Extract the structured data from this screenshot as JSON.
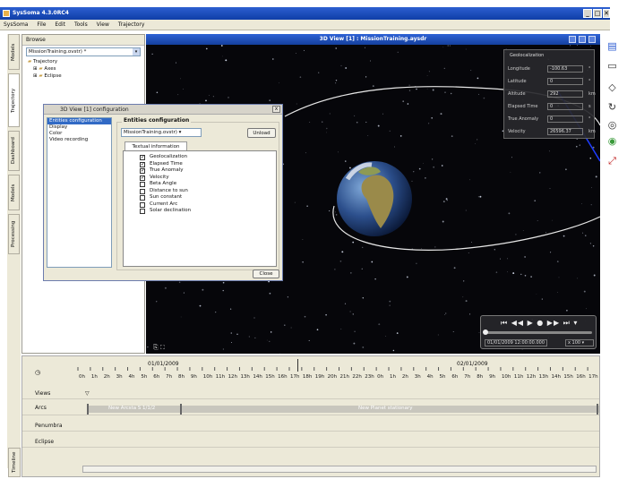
{
  "window": {
    "title": "SysSoma 4.3.0RC4",
    "btn_min": "_",
    "btn_max": "□",
    "btn_close": "✕"
  },
  "menu": [
    "SysSoma",
    "File",
    "Edit",
    "Tools",
    "View",
    "Trajectory"
  ],
  "left_tabs": [
    "Models",
    "Trajectory",
    "Dashboard",
    "Models",
    "Processing"
  ],
  "browse": {
    "title": "Browse",
    "combo": "MissionTraining.ovstr) *",
    "tree": [
      {
        "label": "Trajectory",
        "expander": ""
      },
      {
        "label": "Axes",
        "expander": "⊞"
      },
      {
        "label": "Eclipse",
        "expander": "⊞"
      }
    ]
  },
  "view3d": {
    "title": "3D View [1] : MissionTraining.aysdr"
  },
  "geo_panel": {
    "title": "Geolocalization",
    "rows": [
      {
        "label": "Longitude",
        "value": "-100.63",
        "unit": "°"
      },
      {
        "label": "Latitude",
        "value": "0",
        "unit": "°"
      },
      {
        "label": "Altitude",
        "value": "292",
        "unit": "km"
      },
      {
        "label": "Elapsed Time",
        "value": "0",
        "unit": "s"
      },
      {
        "label": "True Anomaly",
        "value": "0",
        "unit": "°"
      },
      {
        "label": "Velocity",
        "value": "26596.37",
        "unit": "km"
      }
    ]
  },
  "player": {
    "controls": "⏮ ◀◀ ▶ ● ▶▶ ⏭ ▾",
    "date": "01/01/2009 12:00:00.000",
    "speed": "x 100 ▾"
  },
  "dialog": {
    "title": "3D View [1] configuration",
    "close": "x",
    "list": [
      "Entities configuration",
      "Display",
      "Color",
      "Video recording"
    ],
    "group_label": "Entities configuration",
    "combo": "MissionTraining.ovstr) ▾",
    "unload": "Unload",
    "tab": "Textual information",
    "checks": [
      {
        "label": "Geolocalization",
        "checked": "✓"
      },
      {
        "label": "Elapsed Time",
        "checked": "✓"
      },
      {
        "label": "True Anomaly",
        "checked": "✓"
      },
      {
        "label": "Velocity",
        "checked": "✓"
      },
      {
        "label": "Beta Angle",
        "checked": ""
      },
      {
        "label": "Distance to sun",
        "checked": ""
      },
      {
        "label": "Sun constant",
        "checked": ""
      },
      {
        "label": "Current Arc",
        "checked": ""
      },
      {
        "label": "Solar declination",
        "checked": ""
      }
    ],
    "close_btn": "Close"
  },
  "timeline": {
    "date_left": "01/01/2009",
    "date_right": "02/01/2009",
    "hours": [
      "0h",
      "1h",
      "2h",
      "3h",
      "4h",
      "5h",
      "6h",
      "7h",
      "8h",
      "9h",
      "10h",
      "11h",
      "12h",
      "13h",
      "14h",
      "15h",
      "16h",
      "17h",
      "18h",
      "19h",
      "20h",
      "21h",
      "22h",
      "23h",
      "0h",
      "1h",
      "2h",
      "3h",
      "4h",
      "5h",
      "6h",
      "7h",
      "8h",
      "9h",
      "10h",
      "11h",
      "12h",
      "13h",
      "14h",
      "15h",
      "16h",
      "17h"
    ],
    "rows": [
      "Views",
      "Arcs",
      "Penumbra",
      "Eclipse"
    ],
    "arc1": "New Arcsta S 1/1/2",
    "arc2": "New Planet stationary",
    "side_tab": "Timeline",
    "views_marker": "▽",
    "clock_icon": "◷"
  },
  "right_toolbar": [
    "▤",
    "▭",
    "◇",
    "↻",
    "◎",
    "◉",
    "⤢"
  ],
  "colors": {
    "title_blue": "#1a4cc0",
    "orbit": "#e6e6e6",
    "space": "#06060a"
  }
}
